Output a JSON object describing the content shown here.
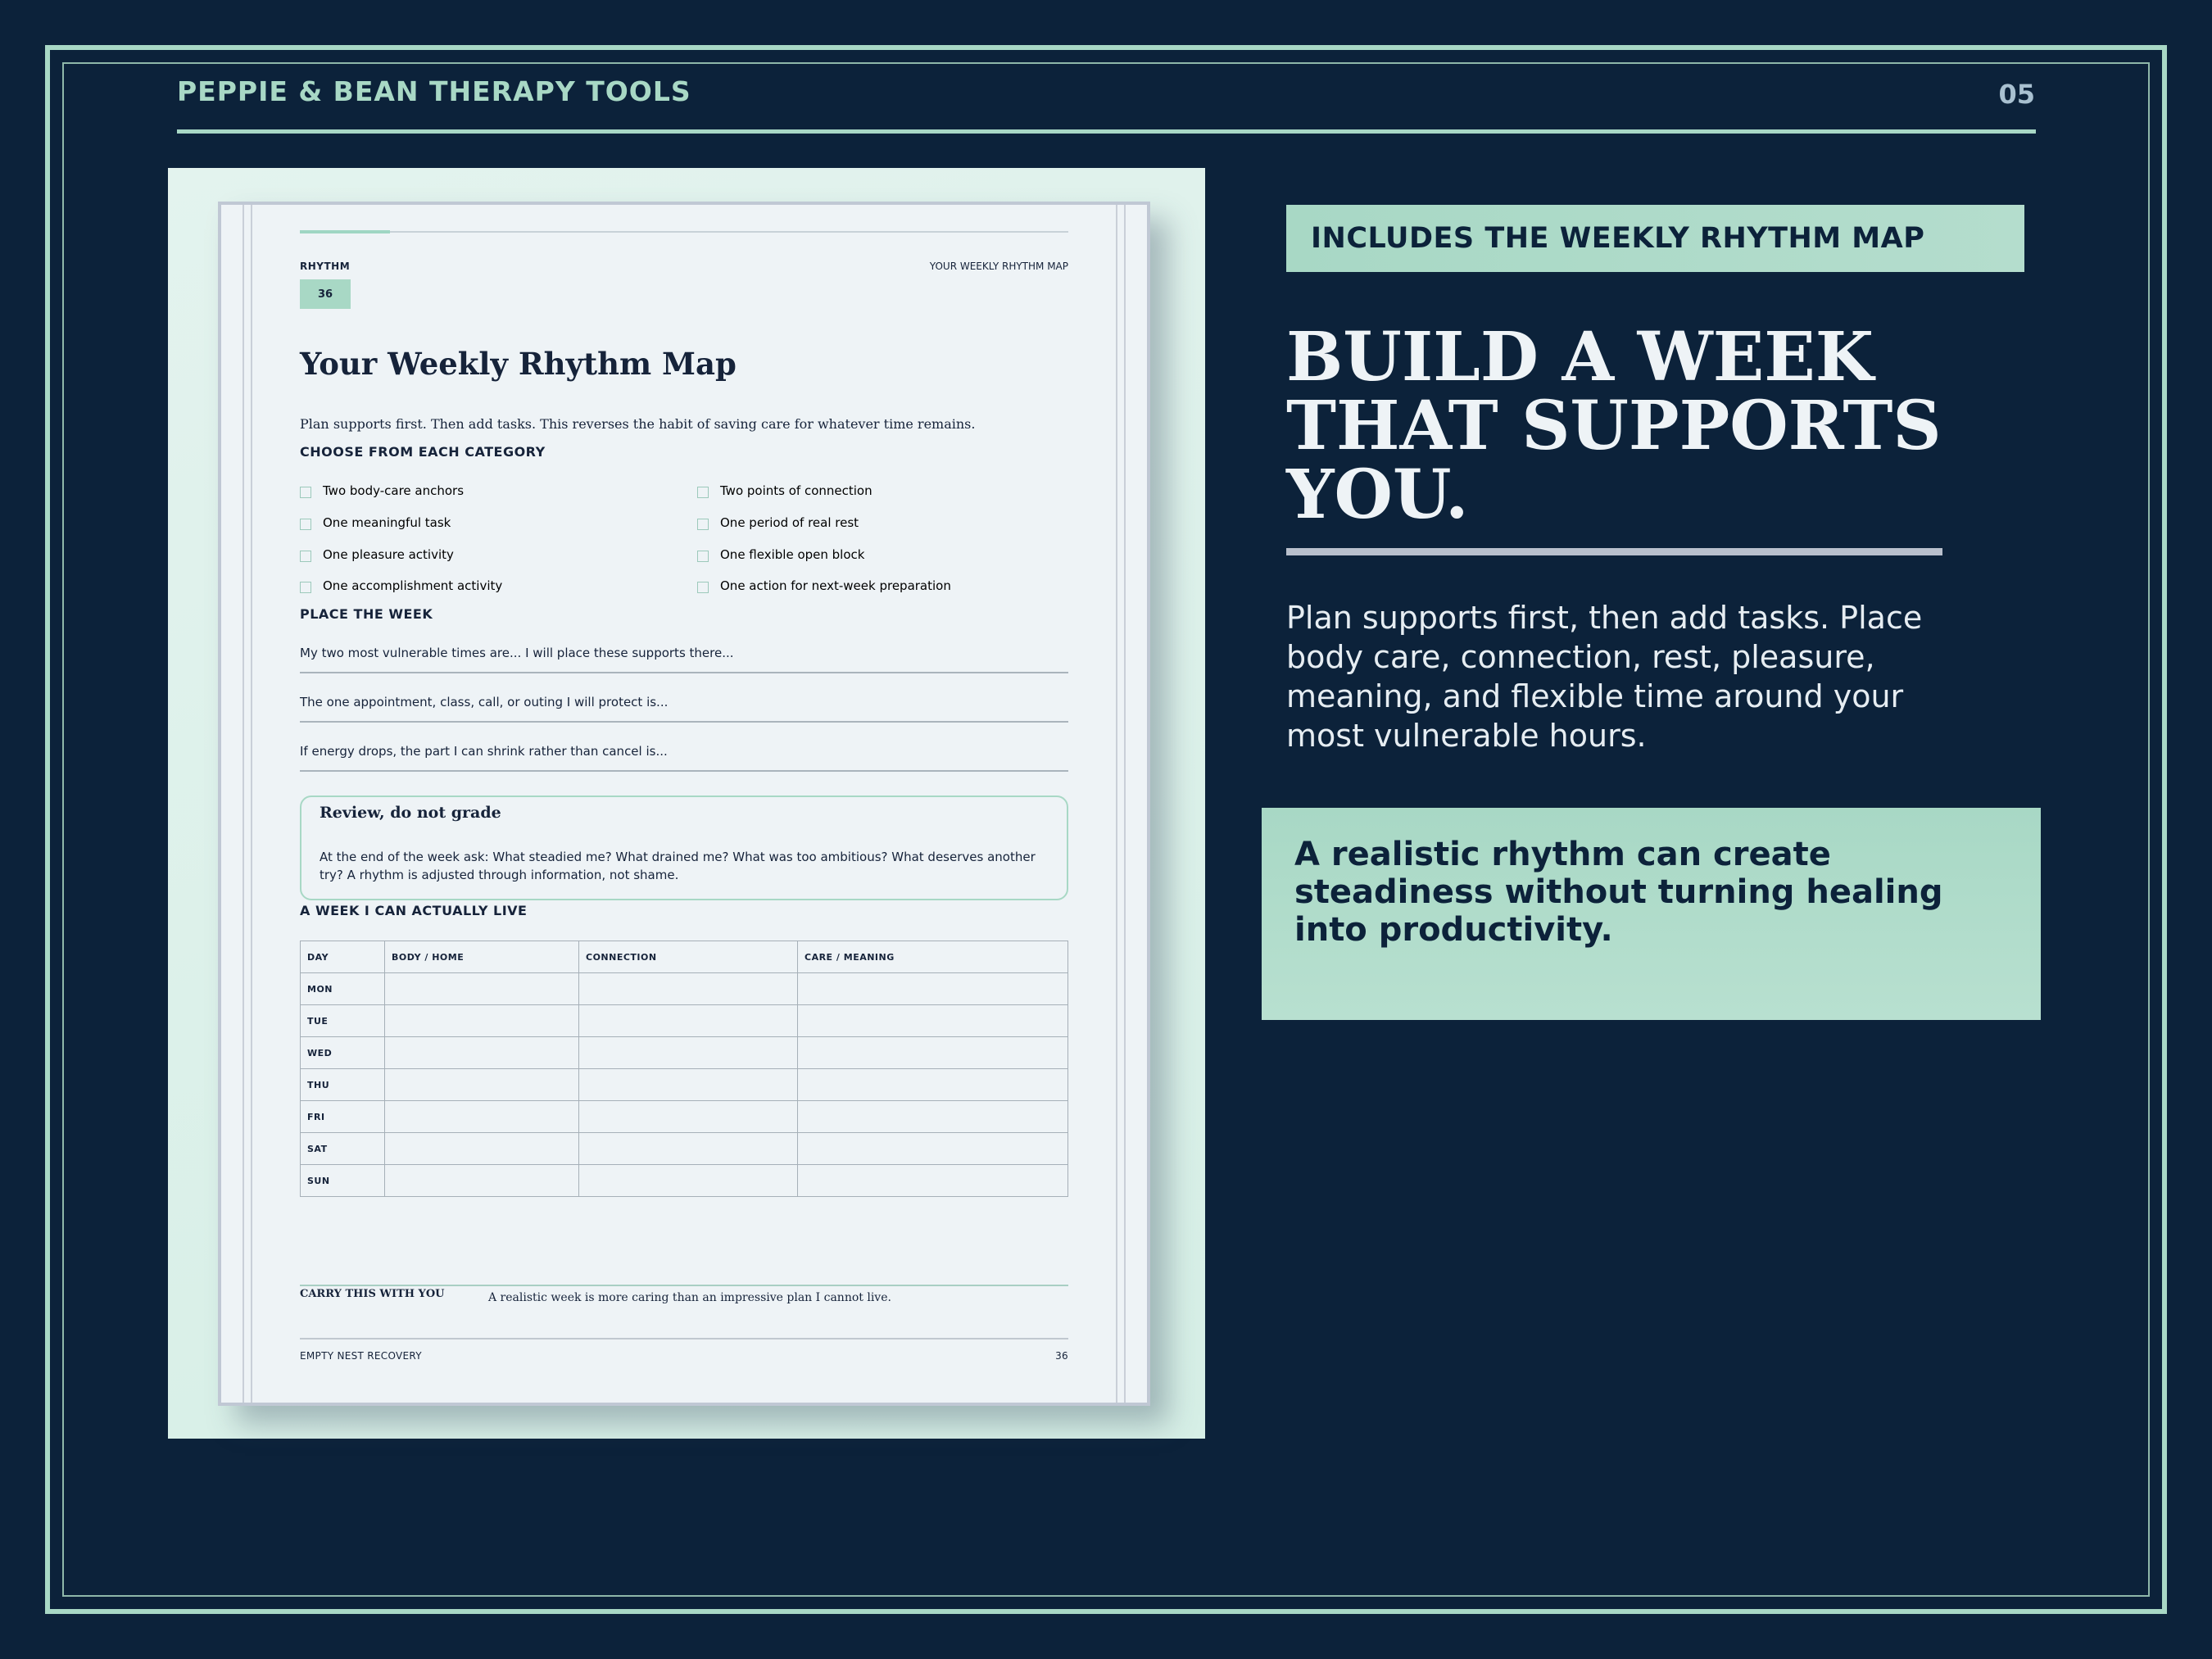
{
  "header": {
    "brand": "PEPPIE & BEAN THERAPY TOOLS",
    "page_number": "05"
  },
  "preview": {
    "top_left_tag": "RHYTHM",
    "top_right_tag": "YOUR WEEKLY RHYTHM MAP",
    "badge": "36",
    "title": "Your Weekly Rhythm Map",
    "intro": "Plan supports first. Then add tasks. This reverses the habit of saving care for whatever time remains.",
    "category_heading": "CHOOSE FROM EACH CATEGORY",
    "checklist_left": [
      "Two body-care anchors",
      "One meaningful task",
      "One pleasure activity",
      "One accomplishment activity"
    ],
    "checklist_right": [
      "Two points of connection",
      "One period of real rest",
      "One flexible open block",
      "One action for next-week preparation"
    ],
    "place_heading": "PLACE THE WEEK",
    "prompts": [
      "My two most vulnerable times are... I will place these supports there...",
      "The one appointment, class, call, or outing I will protect is...",
      "If energy drops, the part I can shrink rather than cancel is..."
    ],
    "review_title": "Review, do not grade",
    "review_body": "At the end of the week ask: What steadied me? What drained me? What was too ambitious? What deserves another try? A rhythm is adjusted through information, not shame.",
    "table_heading": "A WEEK I CAN ACTUALLY LIVE",
    "table_columns": [
      "DAY",
      "BODY / HOME",
      "CONNECTION",
      "CARE / MEANING"
    ],
    "table_days": [
      "MON",
      "TUE",
      "WED",
      "THU",
      "FRI",
      "SAT",
      "SUN"
    ],
    "carry_label": "CARRY THIS WITH YOU",
    "carry_text": "A realistic week is more caring than an impressive plan I cannot live.",
    "footer_left": "EMPTY NEST RECOVERY",
    "footer_right": "36"
  },
  "right": {
    "chip": "INCLUDES THE WEEKLY RHYTHM MAP",
    "headline_lines": [
      "BUILD A WEEK",
      "THAT SUPPORTS",
      "YOU."
    ],
    "body": "Plan supports first, then add tasks. Place body care, connection, rest, pleasure, meaning, and flexible time around your most vulnerable hours.",
    "quote": "A realistic rhythm can create steadiness without turning healing into productivity."
  },
  "colors": {
    "background": "#0c223a",
    "mint": "#a8d8c5",
    "paper": "#eef3f6"
  }
}
